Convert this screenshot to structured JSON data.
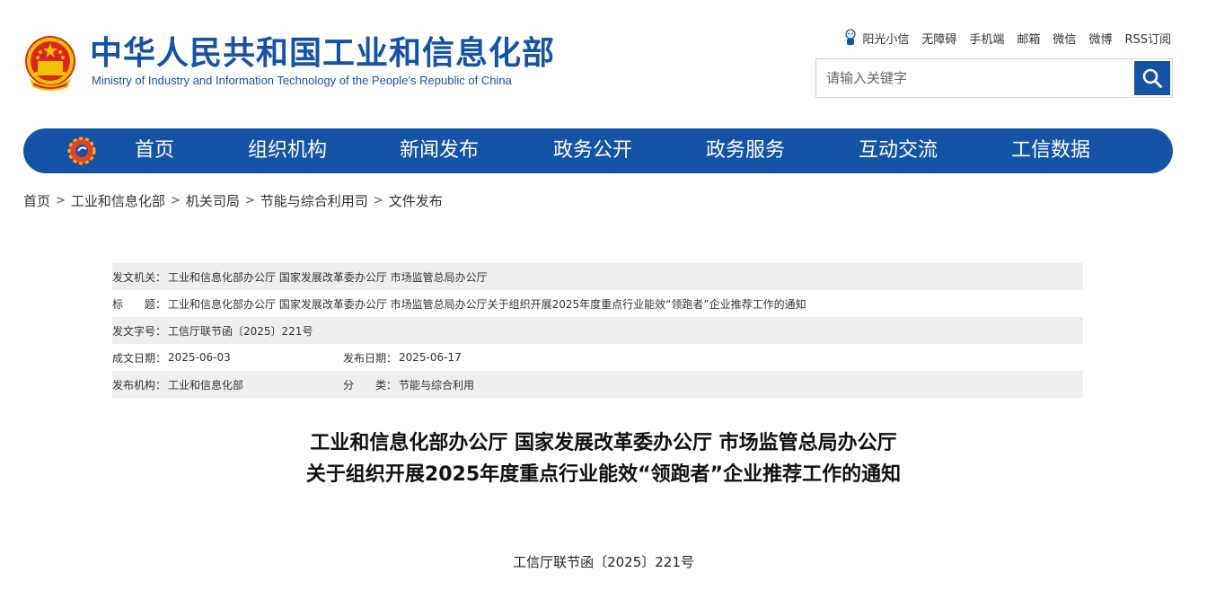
{
  "header": {
    "title": "中华人民共和国工业和信息化部",
    "subtitle": "Ministry of Industry and Information Technology of the People’s Republic of China",
    "top_links": [
      "阳光小信",
      "无障碍",
      "手机端",
      "邮箱",
      "微信",
      "微博",
      "RSS订阅"
    ],
    "search_placeholder": "请输入关键字"
  },
  "nav": {
    "items": [
      "首页",
      "组织机构",
      "新闻发布",
      "政务公开",
      "政务服务",
      "互动交流",
      "工信数据"
    ]
  },
  "breadcrumb": [
    "首页",
    "工业和信息化部",
    "机关司局",
    "节能与综合利用司",
    "文件发布"
  ],
  "info": {
    "issuer_label": "发文机关：",
    "issuer_value": "工业和信息化部办公厅 国家发展改革委办公厅 市场监管总局办公厅",
    "title_label": "标　　题：",
    "title_value": "工业和信息化部办公厅 国家发展改革委办公厅 市场监管总局办公厅关于组织开展2025年度重点行业能效“领跑者”企业推荐工作的通知",
    "docno_label": "发文字号：",
    "docno_value": "工信厅联节函〔2025〕221号",
    "created_label": "成文日期：",
    "created_value": "2025-06-03",
    "published_label": "发布日期：",
    "published_value": "2025-06-17",
    "org_label": "发布机构：",
    "org_value": "工业和信息化部",
    "category_label": "分　　类：",
    "category_value": "节能与综合利用"
  },
  "article": {
    "title_line1": "工业和信息化部办公厅 国家发展改革委办公厅 市场监管总局办公厅",
    "title_line2": "关于组织开展2025年度重点行业能效“领跑者”企业推荐工作的通知",
    "doc_number": "工信厅联节函〔2025〕221号"
  },
  "colors": {
    "brand_blue": "#1553a6",
    "row_shade": "#efefef"
  },
  "icons": [
    "national-emblem-icon",
    "sun-mascot-icon",
    "search-icon",
    "nav-logo-icon"
  ]
}
